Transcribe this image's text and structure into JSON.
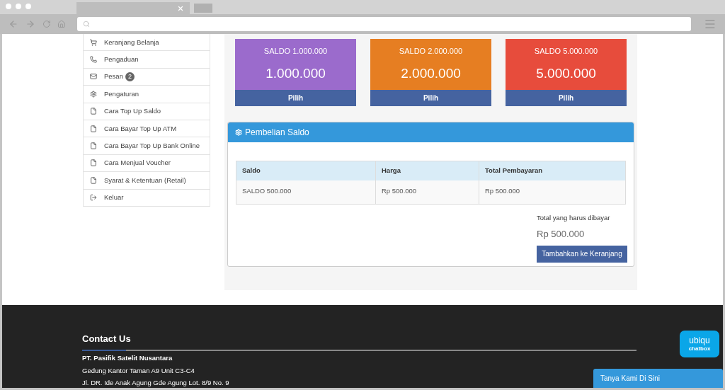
{
  "sidebar": {
    "items": [
      {
        "label": "Keranjang Belanja"
      },
      {
        "label": "Pengaduan"
      },
      {
        "label": "Pesan",
        "badge": "2"
      },
      {
        "label": "Pengaturan"
      },
      {
        "label": "Cara Top Up Saldo"
      },
      {
        "label": "Cara Bayar Top Up ATM"
      },
      {
        "label": "Cara Bayar Top Up Bank Online"
      },
      {
        "label": "Cara Menjual Voucher"
      },
      {
        "label": "Syarat & Ketentuan (Retail)"
      },
      {
        "label": "Keluar"
      }
    ]
  },
  "cards": [
    {
      "title": "SALDO 1.000.000",
      "amount": "1.000.000",
      "button": "Pilih",
      "color": "#9b6bcc"
    },
    {
      "title": "SALDO 2.000.000",
      "amount": "2.000.000",
      "button": "Pilih",
      "color": "#e67e22"
    },
    {
      "title": "SALDO 5.000.000",
      "amount": "5.000.000",
      "button": "Pilih",
      "color": "#e74c3c"
    }
  ],
  "panel": {
    "title": "Pembelian Saldo",
    "table": {
      "columns": [
        "Saldo",
        "Harga",
        "Total Pembayaran"
      ],
      "rows": [
        [
          "SALDO 500.000",
          "Rp 500.000",
          "Rp 500.000"
        ]
      ]
    },
    "total_label": "Total yang harus dibayar",
    "total": "Rp 500.000",
    "button": "Tambahkan ke Keranjang"
  },
  "footer": {
    "heading": "Contact Us",
    "lines": [
      "PT. Pasifik Satelit Nusantara",
      "Gedung Kantor Taman A9 Unit C3-C4",
      "Jl. DR. Ide Anak Agung Gde Agung Lot. 8/9 No. 9"
    ]
  },
  "chat": {
    "logo": [
      "ubiqu",
      "chatbox"
    ],
    "button": "Tanya Kami Di Sini"
  }
}
